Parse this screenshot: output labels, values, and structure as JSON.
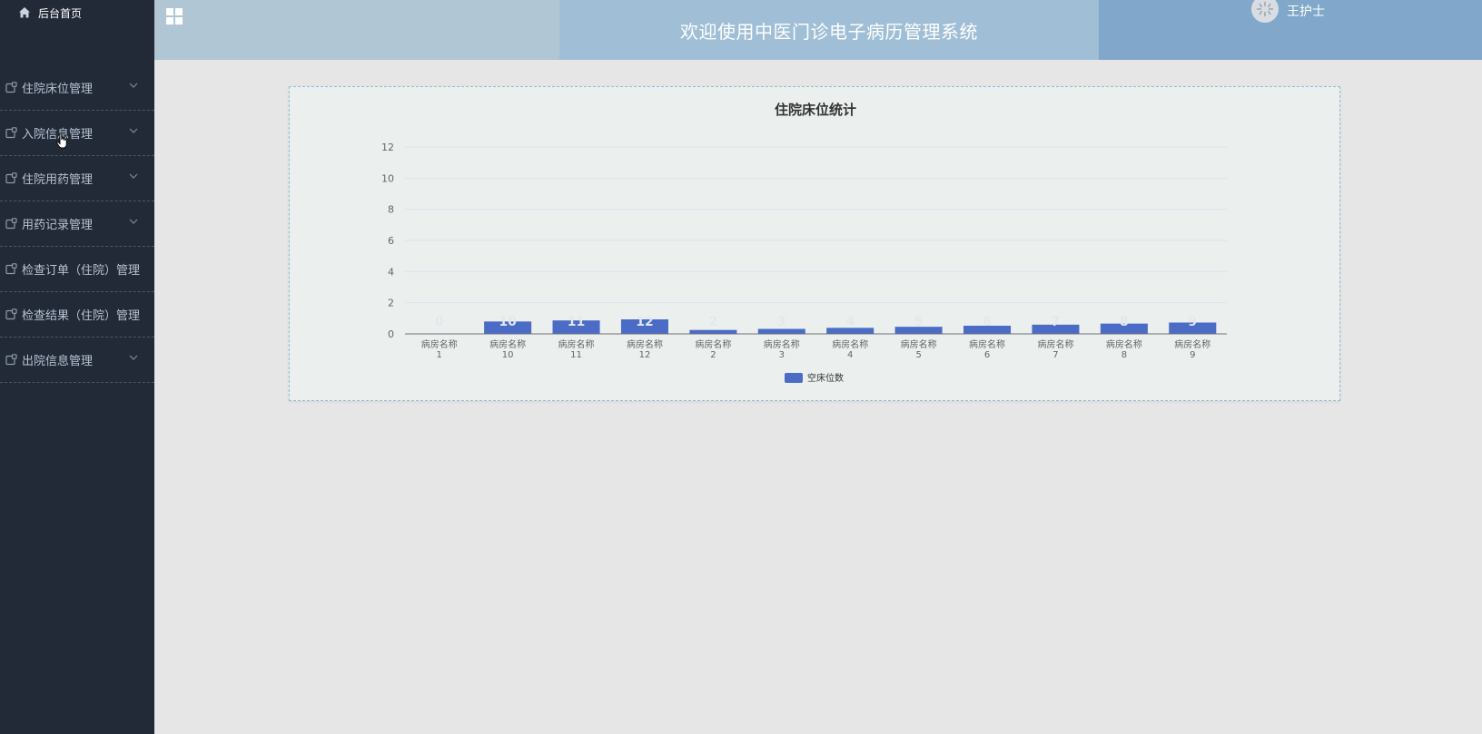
{
  "sidebar": {
    "home_label": "后台首页",
    "items": [
      {
        "label": "住院床位管理",
        "has_chevron": true
      },
      {
        "label": "入院信息管理",
        "has_chevron": true
      },
      {
        "label": "住院用药管理",
        "has_chevron": true
      },
      {
        "label": "用药记录管理",
        "has_chevron": true
      },
      {
        "label": "检查订单（住院）管理",
        "has_chevron": false
      },
      {
        "label": "检查结果（住院）管理",
        "has_chevron": false
      },
      {
        "label": "出院信息管理",
        "has_chevron": true
      }
    ]
  },
  "header": {
    "title": "欢迎使用中医门诊电子病历管理系统",
    "user_name": "王护士",
    "menu_icon": "grid-icon",
    "colors": {
      "seg1": "#b0c6d5",
      "seg2": "#a0bfd6",
      "seg3": "#81a8ca"
    }
  },
  "chart_data": {
    "type": "bar",
    "title": "住院床位统计",
    "categories": [
      [
        "病房名称",
        "1"
      ],
      [
        "病房名称",
        "10"
      ],
      [
        "病房名称",
        "11"
      ],
      [
        "病房名称",
        "12"
      ],
      [
        "病房名称",
        "2"
      ],
      [
        "病房名称",
        "3"
      ],
      [
        "病房名称",
        "4"
      ],
      [
        "病房名称",
        "5"
      ],
      [
        "病房名称",
        "6"
      ],
      [
        "病房名称",
        "7"
      ],
      [
        "病房名称",
        "8"
      ],
      [
        "病房名称",
        "9"
      ]
    ],
    "series": [
      {
        "name": "空床位数",
        "values": [
          0,
          10,
          11,
          12,
          2,
          3,
          4,
          5,
          6,
          7,
          8,
          9
        ],
        "color": "#4a6cc7"
      }
    ],
    "y_ticks": [
      "0",
      "2",
      "4",
      "6",
      "8",
      "10",
      "12"
    ],
    "ylim": [
      0,
      12
    ],
    "bar_scale_note_free": true,
    "grid": true,
    "legend_position": "bottom-center"
  }
}
